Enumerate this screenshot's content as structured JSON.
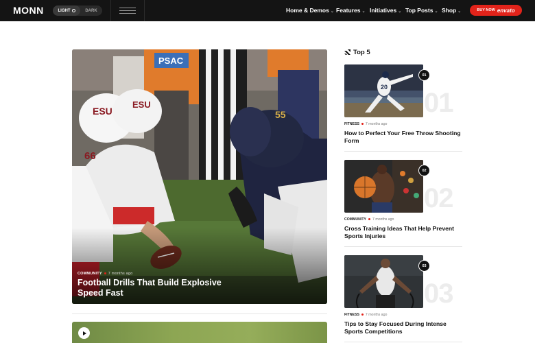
{
  "header": {
    "logo": "MONN",
    "mode_light": "LIGHT",
    "mode_dark": "DARK",
    "nav": [
      {
        "label": "Home & Demos"
      },
      {
        "label": "Features"
      },
      {
        "label": "Initiatives"
      },
      {
        "label": "Top Posts"
      },
      {
        "label": "Shop"
      }
    ],
    "buy_prefix": "BUY NOW",
    "buy_brand": "envato"
  },
  "hero": {
    "category": "COMMUNITY",
    "time": "7 months ago",
    "title": "Football Drills That Build Explosive Speed Fast",
    "jersey_left": "ESU",
    "jersey_right": "55",
    "sign": "PSAC",
    "player_number": "66"
  },
  "sidebar": {
    "title": "Top 5",
    "items": [
      {
        "rank": "01",
        "bignum": "01",
        "category": "FITNESS",
        "time": "7 months ago",
        "title": "How to Perfect Your Free Throw Shooting Form",
        "jersey": "20"
      },
      {
        "rank": "02",
        "bignum": "02",
        "category": "COMMUNITY",
        "time": "7 months ago",
        "title": "Cross Training Ideas That Help Prevent Sports Injuries"
      },
      {
        "rank": "03",
        "bignum": "03",
        "category": "FITNESS",
        "time": "7 months ago",
        "title": "Tips to Stay Focused During Intense Sports Competitions"
      }
    ]
  },
  "colors": {
    "header_bg": "#141414",
    "accent": "#e2231a",
    "bignum": "#ececec"
  }
}
